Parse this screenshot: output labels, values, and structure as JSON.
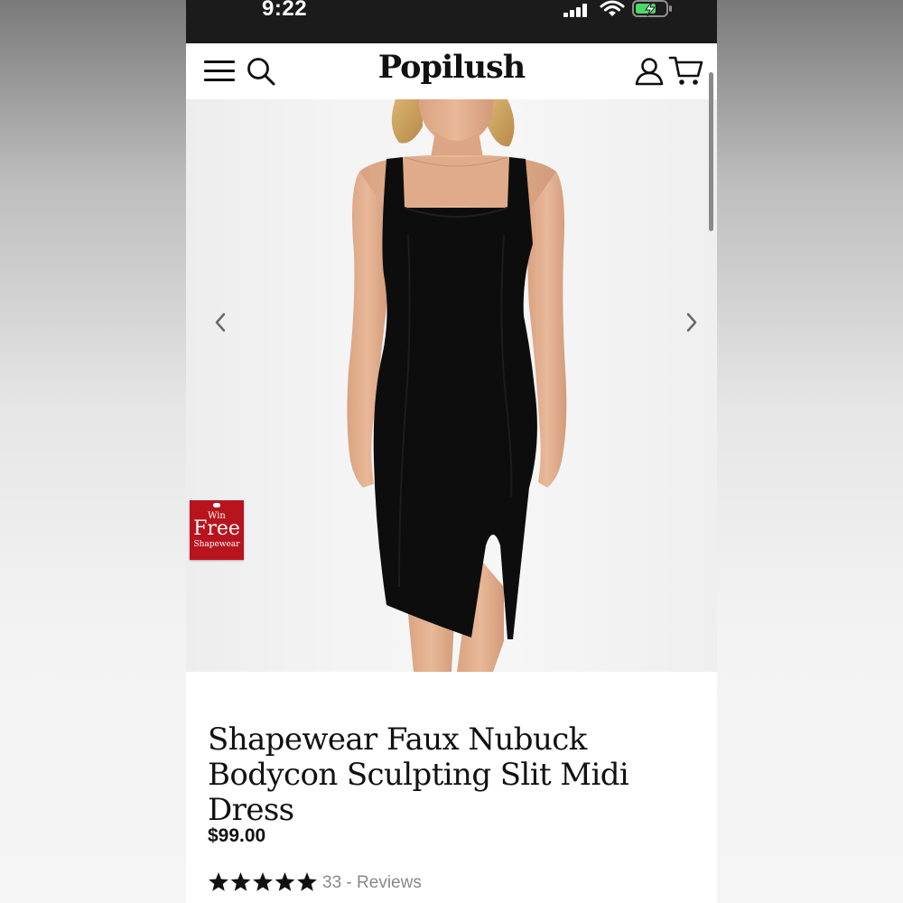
{
  "status_bar": {
    "time": "9:22"
  },
  "header": {
    "brand": "Popilush",
    "icons": [
      "menu-icon",
      "search-icon",
      "account-icon",
      "cart-icon"
    ]
  },
  "gallery": {
    "prev_icon": "chevron-left-icon",
    "next_icon": "chevron-right-icon",
    "promo": {
      "line1": "Win",
      "line2": "Free",
      "line3": "Shapewear"
    }
  },
  "product": {
    "title_line1": "Shapewear Faux Nubuck",
    "title_line2": "Bodycon Sculpting Slit Midi Dress",
    "price": "$99.00",
    "rating": 5,
    "review_count": "33",
    "review_separator": " - ",
    "review_label": "Reviews"
  },
  "colors": {
    "status_bar_bg": "#1b1b1b",
    "promo_red": "#b8141d",
    "battery_green": "#4cd964",
    "text_dark": "#111111",
    "text_muted": "#888888"
  }
}
